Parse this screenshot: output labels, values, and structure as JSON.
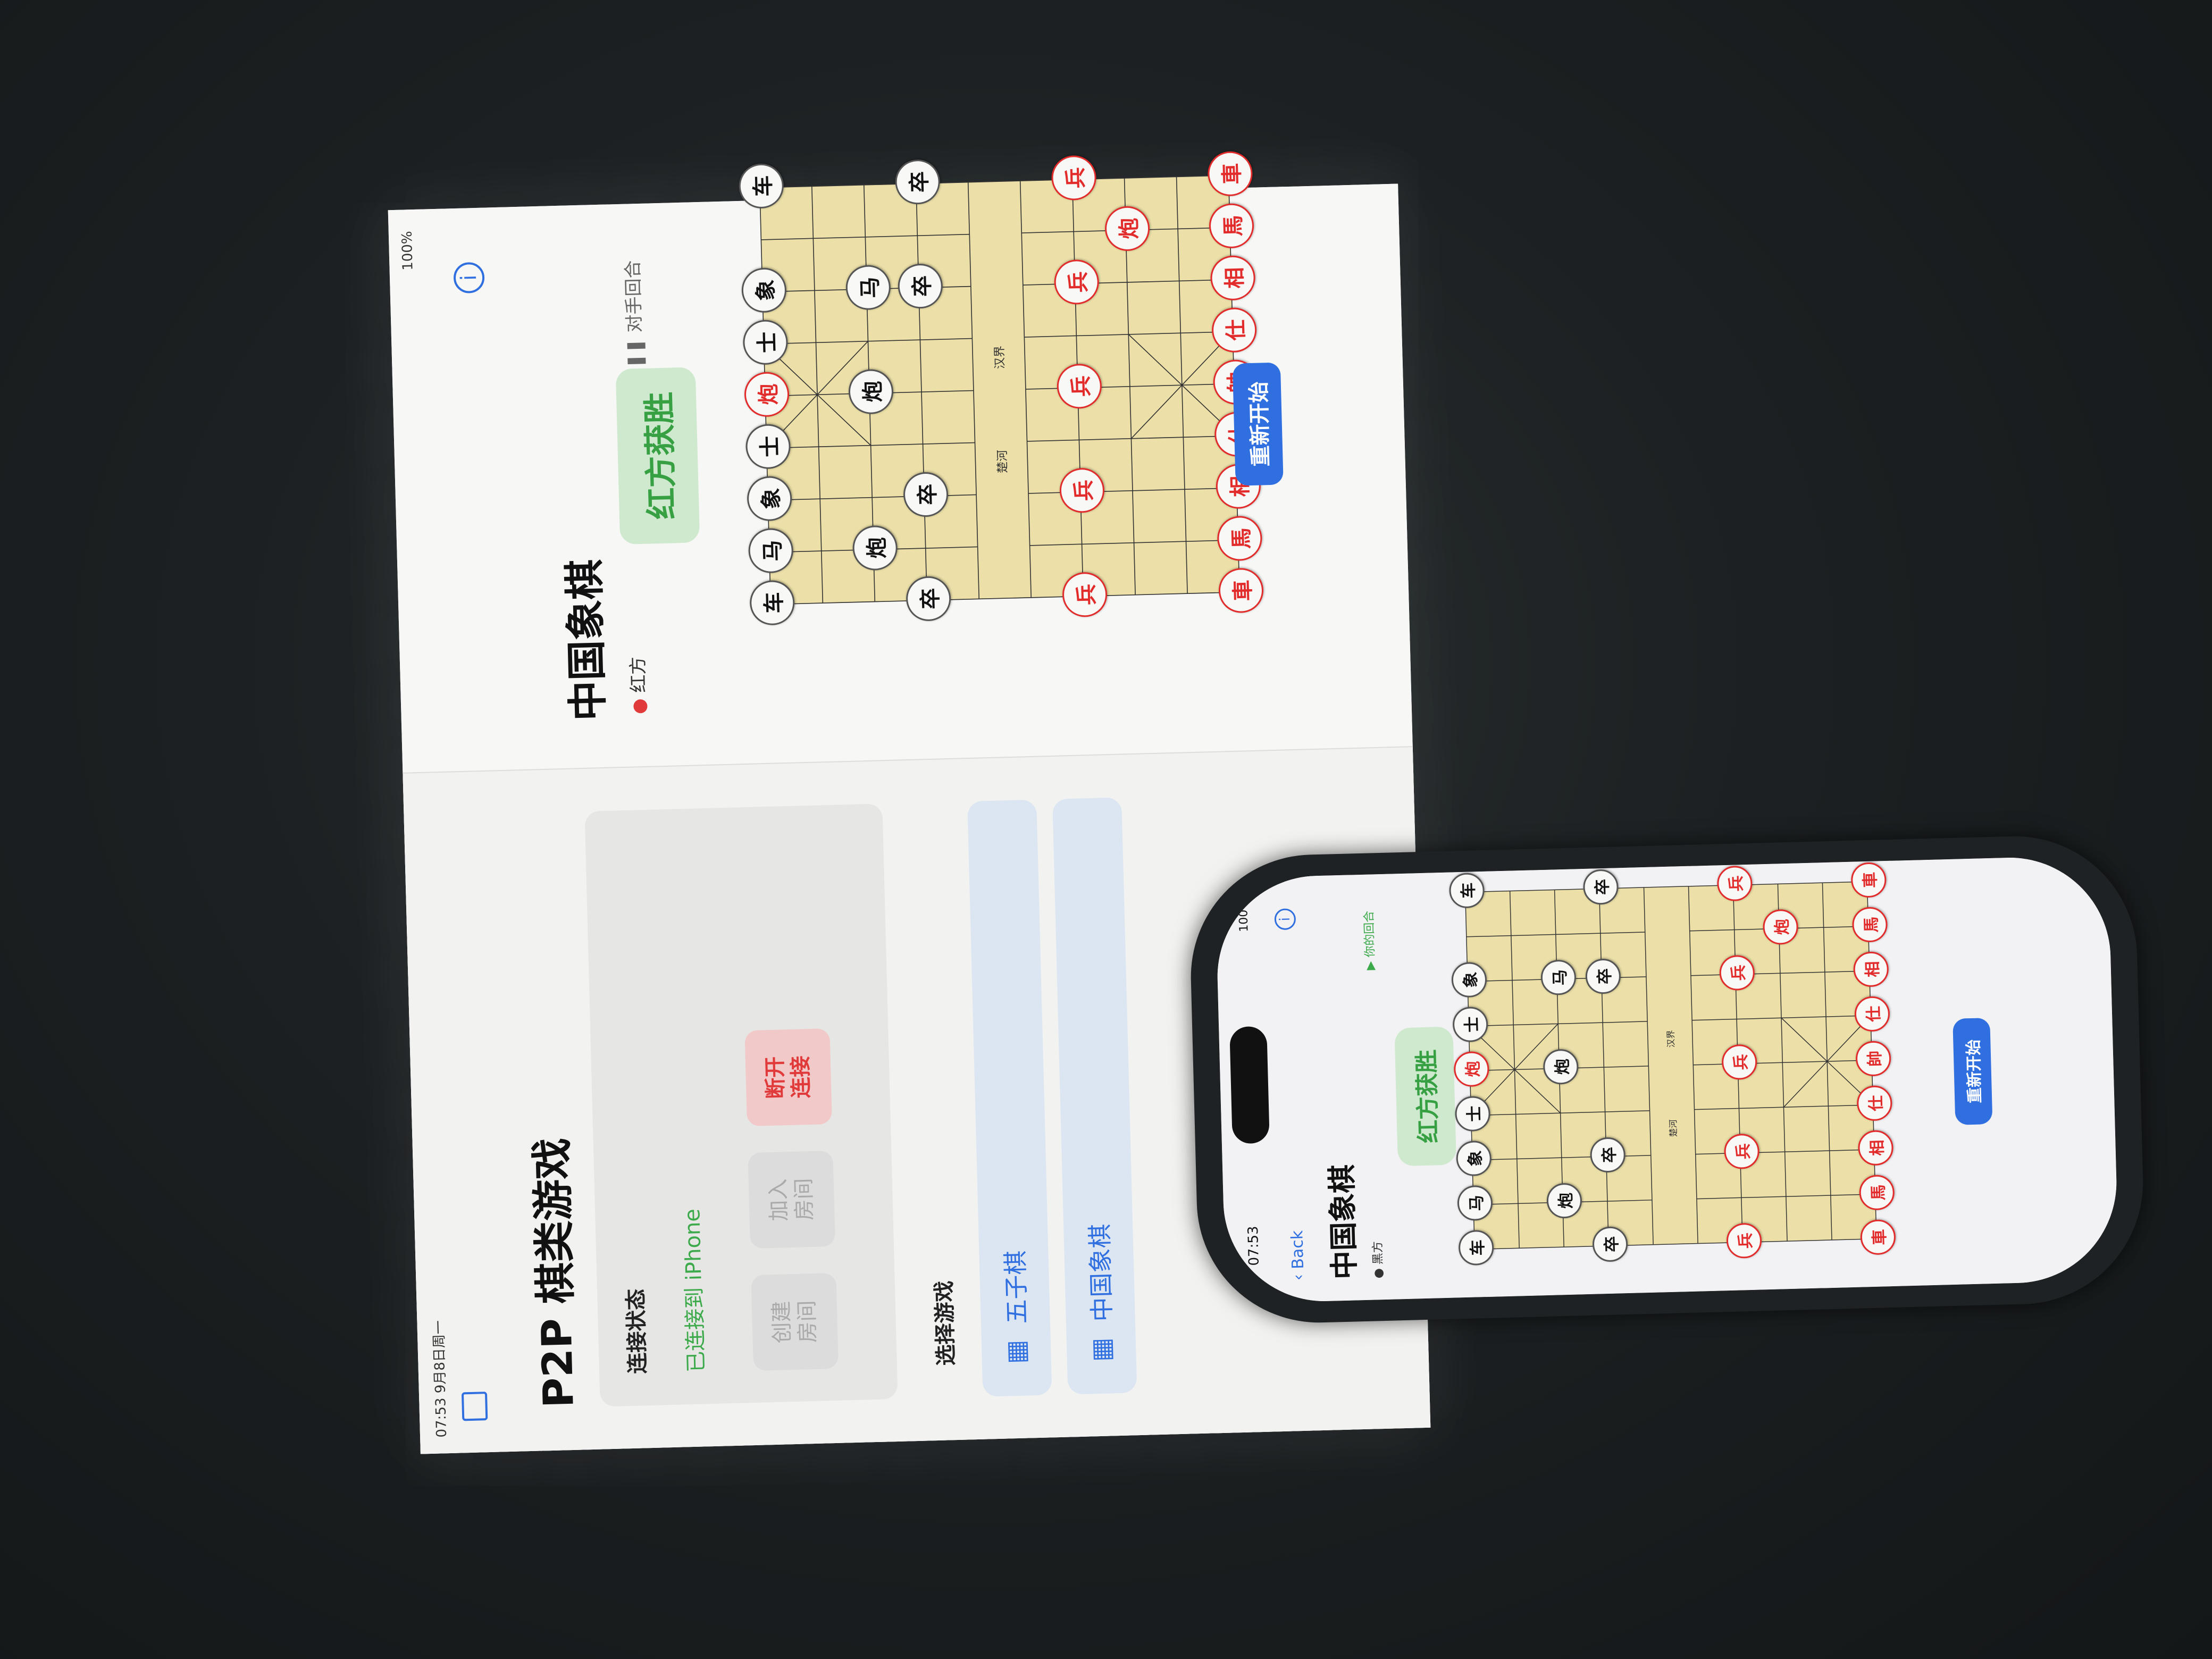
{
  "ipad": {
    "status": {
      "time_date": "07:53 9月8日周一",
      "battery": "100%"
    },
    "sidebar": {
      "app_title": "P2P 棋类游戏",
      "connection_section": "连接状态",
      "connection_text": "已连接到 iPhone",
      "btn_create": "创建\n房间",
      "btn_join": "加入\n房间",
      "btn_disconnect": "断开\n连接",
      "select_game_label": "选择游戏",
      "games": [
        "五子棋",
        "中国象棋"
      ]
    },
    "main": {
      "title": "中国象棋",
      "side_label": "红方",
      "turn_label": "对手回合",
      "win_text": "红方获胜",
      "restart_label": "重新开始",
      "river_left": "楚河",
      "river_right": "汉界"
    }
  },
  "phone": {
    "status": {
      "time": "07:53",
      "battery": "100"
    },
    "back_label": "Back",
    "title": "中国象棋",
    "side_label": "黑方",
    "turn_label": "你的回合",
    "win_text": "红方获胜",
    "restart_label": "重新开始",
    "river_left": "楚河",
    "river_right": "汉界"
  },
  "board_pieces": [
    {
      "c": 0,
      "r": 0,
      "t": "车",
      "s": "black"
    },
    {
      "c": 1,
      "r": 0,
      "t": "马",
      "s": "black"
    },
    {
      "c": 2,
      "r": 0,
      "t": "象",
      "s": "black"
    },
    {
      "c": 3,
      "r": 0,
      "t": "士",
      "s": "black"
    },
    {
      "c": 4,
      "r": 0,
      "t": "炮",
      "s": "red"
    },
    {
      "c": 5,
      "r": 0,
      "t": "士",
      "s": "black"
    },
    {
      "c": 6,
      "r": 0,
      "t": "象",
      "s": "black"
    },
    {
      "c": 8,
      "r": 0,
      "t": "车",
      "s": "black"
    },
    {
      "c": 1,
      "r": 2,
      "t": "炮",
      "s": "black"
    },
    {
      "c": 4,
      "r": 2,
      "t": "炮",
      "s": "black"
    },
    {
      "c": 6,
      "r": 2,
      "t": "马",
      "s": "black"
    },
    {
      "c": 0,
      "r": 3,
      "t": "卒",
      "s": "black"
    },
    {
      "c": 2,
      "r": 3,
      "t": "卒",
      "s": "black"
    },
    {
      "c": 6,
      "r": 3,
      "t": "卒",
      "s": "black"
    },
    {
      "c": 8,
      "r": 3,
      "t": "卒",
      "s": "black"
    },
    {
      "c": 0,
      "r": 6,
      "t": "兵",
      "s": "red"
    },
    {
      "c": 2,
      "r": 6,
      "t": "兵",
      "s": "red"
    },
    {
      "c": 4,
      "r": 6,
      "t": "兵",
      "s": "red"
    },
    {
      "c": 6,
      "r": 6,
      "t": "兵",
      "s": "red"
    },
    {
      "c": 8,
      "r": 6,
      "t": "兵",
      "s": "red"
    },
    {
      "c": 7,
      "r": 7,
      "t": "炮",
      "s": "red"
    },
    {
      "c": 0,
      "r": 9,
      "t": "車",
      "s": "red"
    },
    {
      "c": 1,
      "r": 9,
      "t": "馬",
      "s": "red"
    },
    {
      "c": 2,
      "r": 9,
      "t": "相",
      "s": "red"
    },
    {
      "c": 3,
      "r": 9,
      "t": "仕",
      "s": "red"
    },
    {
      "c": 4,
      "r": 9,
      "t": "帥",
      "s": "red"
    },
    {
      "c": 5,
      "r": 9,
      "t": "仕",
      "s": "red"
    },
    {
      "c": 6,
      "r": 9,
      "t": "相",
      "s": "red"
    },
    {
      "c": 7,
      "r": 9,
      "t": "馬",
      "s": "red"
    },
    {
      "c": 8,
      "r": 9,
      "t": "車",
      "s": "red"
    }
  ]
}
